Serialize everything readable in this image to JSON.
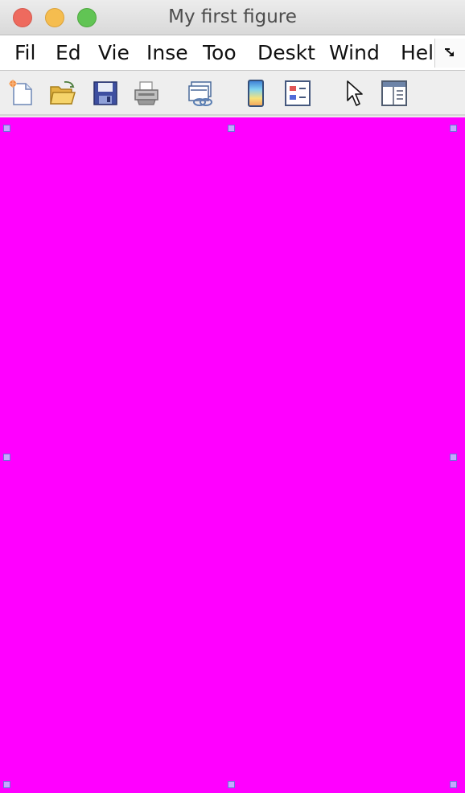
{
  "window": {
    "title": "My first figure"
  },
  "menubar": {
    "items": [
      {
        "label": "Fil"
      },
      {
        "label": "Ed"
      },
      {
        "label": "Vie"
      },
      {
        "label": "Inse"
      },
      {
        "label": "Too"
      },
      {
        "label": "Deskt"
      },
      {
        "label": "Wind"
      },
      {
        "label": "Hel"
      }
    ],
    "overflow_icon": "overflow-arrow-icon"
  },
  "toolbar": {
    "tools": [
      {
        "icon": "new-figure-icon"
      },
      {
        "icon": "open-file-icon"
      },
      {
        "icon": "save-icon"
      },
      {
        "icon": "print-icon"
      },
      {
        "icon": "link-plot-icon"
      },
      {
        "icon": "insert-colorbar-icon"
      },
      {
        "icon": "insert-legend-icon"
      },
      {
        "icon": "edit-plot-pointer-icon"
      },
      {
        "icon": "property-inspector-icon"
      }
    ]
  },
  "canvas": {
    "background_color": "#ff00ff",
    "selection_handle_color": "#c5a6ff"
  }
}
